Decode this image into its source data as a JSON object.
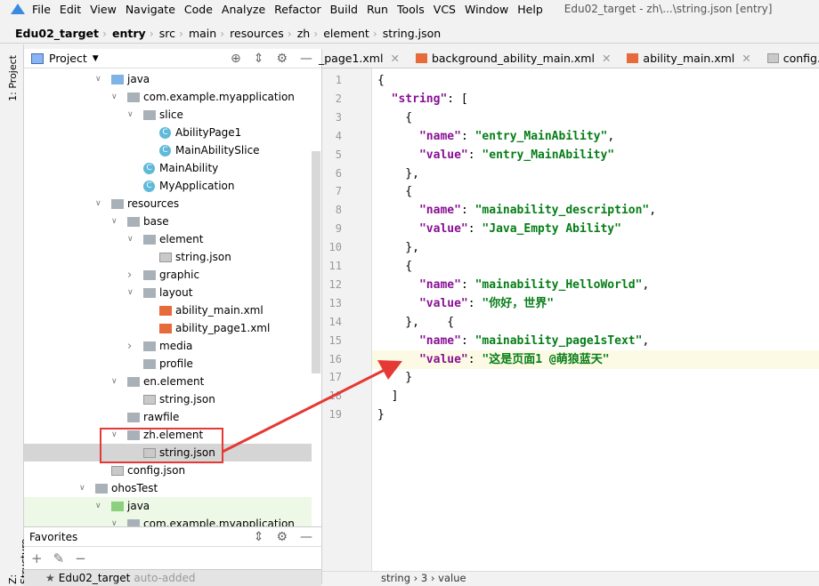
{
  "menu": {
    "items": [
      "File",
      "Edit",
      "View",
      "Navigate",
      "Code",
      "Analyze",
      "Refactor",
      "Build",
      "Run",
      "Tools",
      "VCS",
      "Window",
      "Help"
    ],
    "title": "Edu02_target - zh\\...\\string.json [entry]"
  },
  "breadcrumb": [
    "Edu02_target",
    "entry",
    "src",
    "main",
    "resources",
    "zh",
    "element",
    "string.json"
  ],
  "side_tools": {
    "project": "1: Project",
    "structure": "Z: Structure"
  },
  "project_panel": {
    "title": "Project",
    "tree": [
      {
        "label": "java",
        "level": 0,
        "type": "folder-blue",
        "expanded": true
      },
      {
        "label": "com.example.myapplication",
        "level": 1,
        "type": "folder",
        "expanded": true
      },
      {
        "label": "slice",
        "level": 2,
        "type": "folder",
        "expanded": true
      },
      {
        "label": "AbilityPage1",
        "level": 3,
        "type": "class"
      },
      {
        "label": "MainAbilitySlice",
        "level": 3,
        "type": "class"
      },
      {
        "label": "MainAbility",
        "level": 2,
        "type": "class"
      },
      {
        "label": "MyApplication",
        "level": 2,
        "type": "class"
      },
      {
        "label": "resources",
        "level": 0,
        "type": "folder",
        "expanded": true
      },
      {
        "label": "base",
        "level": 1,
        "type": "folder",
        "expanded": true
      },
      {
        "label": "element",
        "level": 2,
        "type": "folder",
        "expanded": true
      },
      {
        "label": "string.json",
        "level": 3,
        "type": "json"
      },
      {
        "label": "graphic",
        "level": 2,
        "type": "folder",
        "expanded": false
      },
      {
        "label": "layout",
        "level": 2,
        "type": "folder",
        "expanded": true
      },
      {
        "label": "ability_main.xml",
        "level": 3,
        "type": "xml"
      },
      {
        "label": "ability_page1.xml",
        "level": 3,
        "type": "xml"
      },
      {
        "label": "media",
        "level": 2,
        "type": "folder",
        "expanded": false
      },
      {
        "label": "profile",
        "level": 2,
        "type": "folder"
      },
      {
        "label": "en.element",
        "level": 1,
        "type": "folder",
        "expanded": true
      },
      {
        "label": "string.json",
        "level": 2,
        "type": "json"
      },
      {
        "label": "rawfile",
        "level": 1,
        "type": "folder"
      },
      {
        "label": "zh.element",
        "level": 1,
        "type": "folder",
        "expanded": true
      },
      {
        "label": "string.json",
        "level": 2,
        "type": "json",
        "selected": true
      },
      {
        "label": "config.json",
        "level": 0,
        "type": "json"
      },
      {
        "label": "ohosTest",
        "level": -1,
        "type": "folder",
        "expanded": true
      },
      {
        "label": "java",
        "level": 0,
        "type": "folder-green",
        "expanded": true
      },
      {
        "label": "com.example.myapplication",
        "level": 1,
        "type": "folder",
        "expanded": true
      }
    ]
  },
  "favorites": {
    "title": "Favorites",
    "item": "Edu02_target",
    "item_note": "auto-added"
  },
  "tabs": [
    {
      "label": "_page1.xml",
      "type": "xml"
    },
    {
      "label": "background_ability_main.xml",
      "type": "xml"
    },
    {
      "label": "ability_main.xml",
      "type": "xml"
    },
    {
      "label": "config.json",
      "type": "json"
    }
  ],
  "code": [
    [
      [
        "p",
        "{"
      ]
    ],
    [
      [
        "p",
        "  "
      ],
      [
        "k",
        "\"string\""
      ],
      [
        "p",
        ": ["
      ]
    ],
    [
      [
        "p",
        "    {"
      ]
    ],
    [
      [
        "p",
        "      "
      ],
      [
        "k",
        "\"name\""
      ],
      [
        "p",
        ": "
      ],
      [
        "s",
        "\"entry_MainAbility\""
      ],
      [
        "p",
        ","
      ]
    ],
    [
      [
        "p",
        "      "
      ],
      [
        "k",
        "\"value\""
      ],
      [
        "p",
        ": "
      ],
      [
        "s",
        "\"entry_MainAbility\""
      ]
    ],
    [
      [
        "p",
        "    },"
      ]
    ],
    [
      [
        "p",
        "    {"
      ]
    ],
    [
      [
        "p",
        "      "
      ],
      [
        "k",
        "\"name\""
      ],
      [
        "p",
        ": "
      ],
      [
        "s",
        "\"mainability_description\""
      ],
      [
        "p",
        ","
      ]
    ],
    [
      [
        "p",
        "      "
      ],
      [
        "k",
        "\"value\""
      ],
      [
        "p",
        ": "
      ],
      [
        "s",
        "\"Java_Empty Ability\""
      ]
    ],
    [
      [
        "p",
        "    },"
      ]
    ],
    [
      [
        "p",
        "    {"
      ]
    ],
    [
      [
        "p",
        "      "
      ],
      [
        "k",
        "\"name\""
      ],
      [
        "p",
        ": "
      ],
      [
        "s",
        "\"mainability_HelloWorld\""
      ],
      [
        "p",
        ","
      ]
    ],
    [
      [
        "p",
        "      "
      ],
      [
        "k",
        "\"value\""
      ],
      [
        "p",
        ": "
      ],
      [
        "s",
        "\"你好，世界\""
      ]
    ],
    [
      [
        "p",
        "    },    {"
      ]
    ],
    [
      [
        "p",
        "      "
      ],
      [
        "k",
        "\"name\""
      ],
      [
        "p",
        ": "
      ],
      [
        "s",
        "\"mainability_page1sText\""
      ],
      [
        "p",
        ","
      ]
    ],
    [
      [
        "p",
        "      "
      ],
      [
        "k",
        "\"value\""
      ],
      [
        "p",
        ": "
      ],
      [
        "s",
        "\"这是页面1 @萌狼蓝天\""
      ]
    ],
    [
      [
        "p",
        "    }"
      ]
    ],
    [
      [
        "p",
        "  ]"
      ]
    ],
    [
      [
        "p",
        "}"
      ]
    ]
  ],
  "highlight_line": 16,
  "status_breadcrumb": "string  ›  3  ›  value",
  "colors": {
    "annotation": "#e53935",
    "key": "#871094",
    "string": "#067d17"
  }
}
